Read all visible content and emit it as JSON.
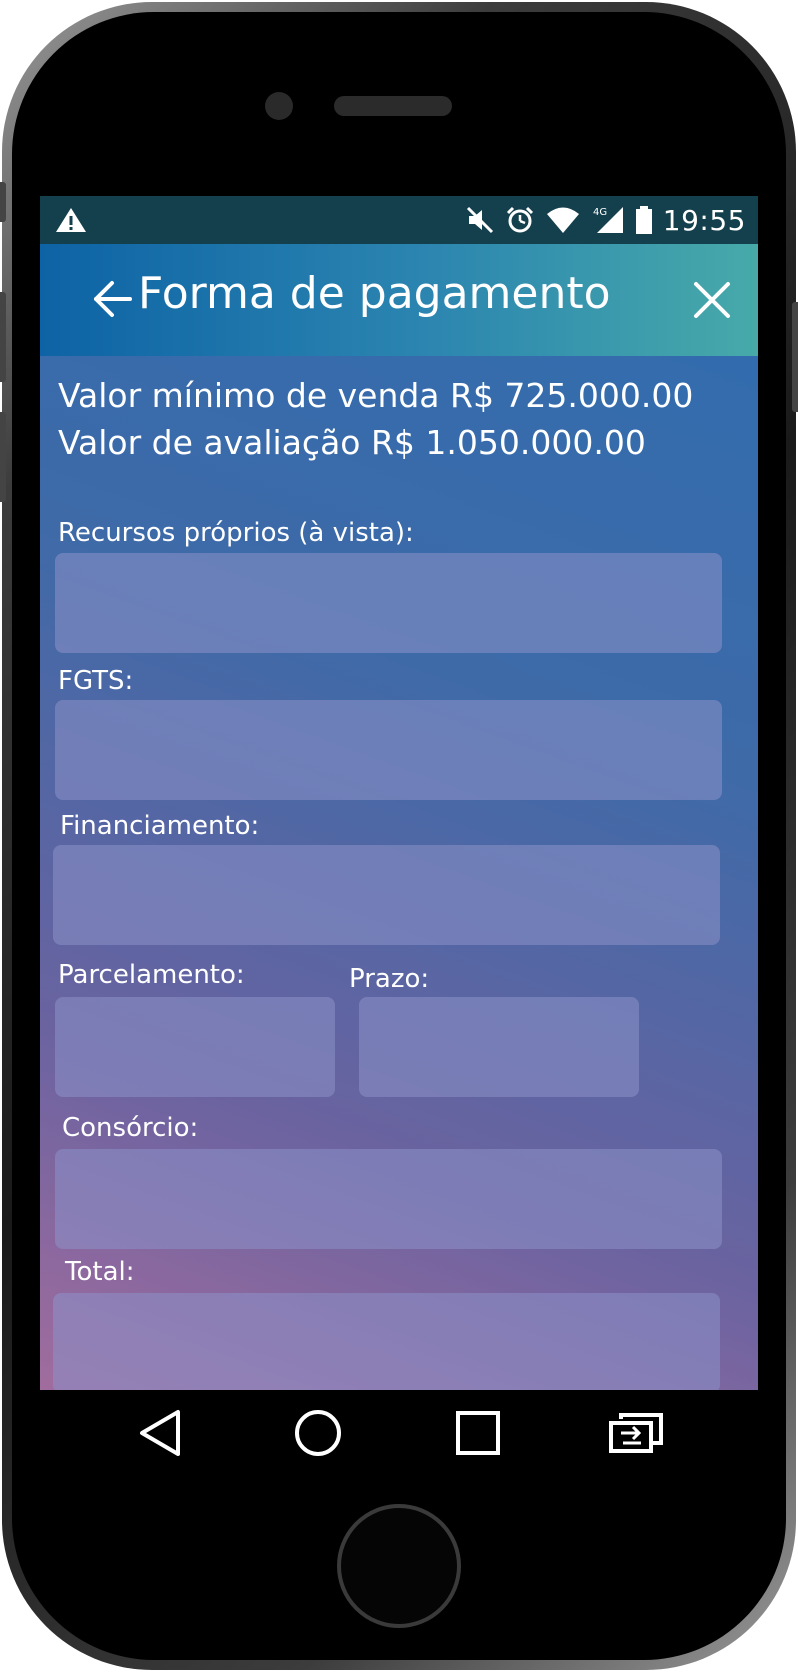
{
  "status_bar": {
    "time": "19:55",
    "network_type": "4G",
    "icons": [
      "warning-icon",
      "mute-icon",
      "alarm-icon",
      "wifi-icon",
      "signal-icon",
      "battery-icon"
    ]
  },
  "appbar": {
    "title": "Forma de pagamento",
    "back_icon": "arrow-left-icon",
    "close_icon": "close-icon"
  },
  "info": {
    "min_value_line": "Valor mínimo de venda R$ 725.000.00",
    "evaluation_line": "Valor de avaliação R$ 1.050.000.00"
  },
  "form": {
    "recursos_label": "Recursos próprios (à vista):",
    "recursos_value": "",
    "fgts_label": "FGTS:",
    "fgts_value": "",
    "financiamento_label": "Financiamento:",
    "financiamento_value": "",
    "parcelamento_label": "Parcelamento:",
    "parcelamento_value": "",
    "prazo_label": "Prazo:",
    "prazo_value": "",
    "consorcio_label": "Consórcio:",
    "consorcio_value": "",
    "total_label": "Total:",
    "total_value": ""
  },
  "navbar": {
    "icons": [
      "back-triangle-icon",
      "home-circle-icon",
      "recents-square-icon",
      "switch-app-icon"
    ]
  },
  "colors": {
    "status_bar": "#14404d",
    "appbar_start": "#0d63a5",
    "appbar_end": "#47aaa9",
    "field_fill": "#8c91c8"
  }
}
